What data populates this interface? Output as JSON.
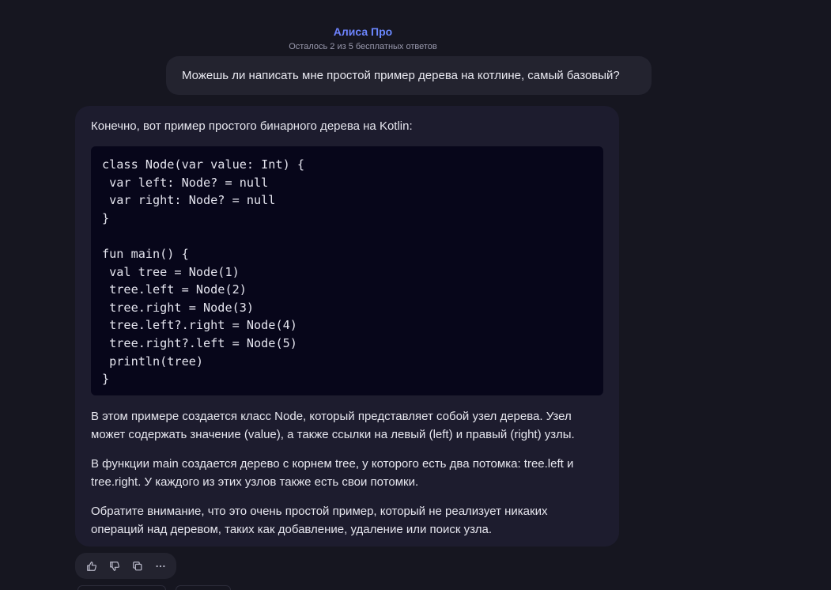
{
  "header": {
    "brand": "Алиса Про",
    "quota": "Осталось 2 из 5 бесплатных ответов"
  },
  "user_message": "Можешь ли написать мне простой пример дерева на котлине, самый базовый?",
  "bot_message": {
    "intro": "Конечно, вот пример простого бинарного дерева на Kotlin:",
    "code": "class Node(var value: Int) {\n var left: Node? = null\n var right: Node? = null\n}\n\nfun main() {\n val tree = Node(1)\n tree.left = Node(2)\n tree.right = Node(3)\n tree.left?.right = Node(4)\n tree.right?.left = Node(5)\n println(tree)\n}",
    "paragraphs": [
      "В этом примере создается класс Node, который представляет собой узел дерева. Узел может содержать значение (value), а также ссылки на левый (left) и правый (right) узлы.",
      "В функции main создается дерево с корнем tree, у которого есть два потомка: tree.left и tree.right. У каждого из этих узлов также есть свои потомки.",
      "Обратите внимание, что это очень простой пример, который не реализует никаких операций над деревом, таких как добавление, удаление или поиск узла."
    ]
  },
  "actions": [
    {
      "icon": "thumbs-up-icon"
    },
    {
      "icon": "thumbs-down-icon"
    },
    {
      "icon": "copy-icon"
    },
    {
      "icon": "more-icon"
    }
  ],
  "colors": {
    "background": "#161620",
    "user_bubble": "#23232f",
    "bot_bubble": "#1d1c2e",
    "code_bg": "#07061a",
    "brand_gradient_start": "#8a5cff",
    "brand_gradient_end": "#4fb0ff"
  }
}
